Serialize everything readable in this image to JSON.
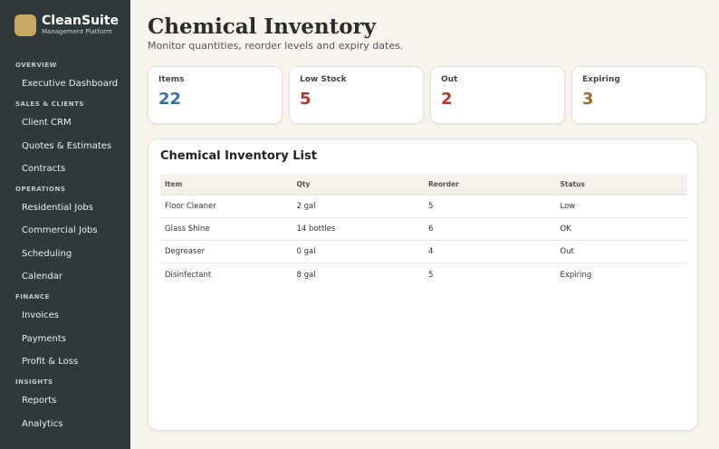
{
  "brand": {
    "name": "CleanSuite",
    "subtitle": "Management Platform"
  },
  "sidebar": {
    "sections": [
      {
        "label": "OVERVIEW",
        "items": [
          "Executive Dashboard"
        ]
      },
      {
        "label": "SALES & CLIENTS",
        "items": [
          "Client CRM",
          "Quotes & Estimates",
          "Contracts"
        ]
      },
      {
        "label": "OPERATIONS",
        "items": [
          "Residential Jobs",
          "Commercial Jobs",
          "Scheduling",
          "Calendar"
        ]
      },
      {
        "label": "FINANCE",
        "items": [
          "Invoices",
          "Payments",
          "Profit & Loss"
        ]
      },
      {
        "label": "INSIGHTS",
        "items": [
          "Reports",
          "Analytics"
        ]
      }
    ]
  },
  "page": {
    "title": "Chemical Inventory",
    "subtitle": "Monitor quantities, reorder levels and expiry dates."
  },
  "stats": [
    {
      "label": "Items",
      "value": "22",
      "color": "#3a6e9f"
    },
    {
      "label": "Low Stock",
      "value": "5",
      "color": "#a83a32"
    },
    {
      "label": "Out",
      "value": "2",
      "color": "#a83a32"
    },
    {
      "label": "Expiring",
      "value": "3",
      "color": "#8f6e2e"
    }
  ],
  "inventory": {
    "title": "Chemical Inventory List",
    "columns": [
      "Item",
      "Qty",
      "Reorder",
      "Status"
    ],
    "rows": [
      [
        "Floor Cleaner",
        "2 gal",
        "5",
        "Low"
      ],
      [
        "Glass Shine",
        "14 bottles",
        "6",
        "OK"
      ],
      [
        "Degreaser",
        "0 gal",
        "4",
        "Out"
      ],
      [
        "Disinfectant",
        "8 gal",
        "5",
        "Expiring"
      ]
    ]
  },
  "colors": {
    "sidebar": "#2d3a39",
    "accent": "#c9a861",
    "background": "#f7f4ee"
  }
}
